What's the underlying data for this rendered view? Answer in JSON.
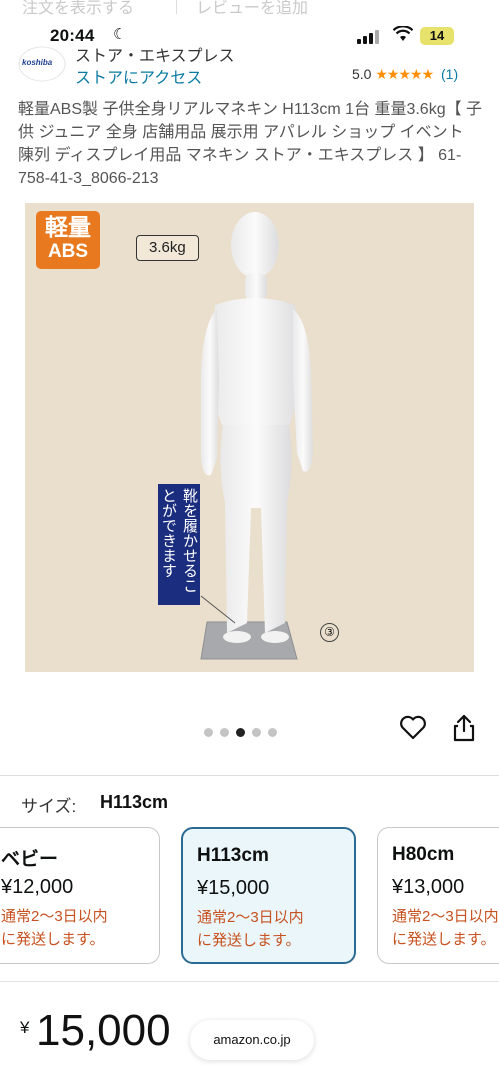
{
  "background_top": {
    "left_text": "注文を表示する",
    "right_text": "レビューを追加"
  },
  "status_bar": {
    "time": "20:44",
    "battery": "14"
  },
  "store": {
    "logo_text": "koshiba",
    "name": "ストア・エキスプレス",
    "link": "ストアにアクセス",
    "rating": "5.0",
    "stars": "★★★★★",
    "rating_count": "(1)"
  },
  "product": {
    "title": "軽量ABS製 子供全身リアルマネキン H113cm 1台 重量3.6kg【 子供 ジュニア 全身 店舗用品 展示用 アパレル ショップ イベント 陳列 ディスプレイ用品 マネキン ストア・エキスプレス 】 61-758-41-3_8066-213",
    "image": {
      "badge_top": "軽量",
      "badge_bottom": "ABS",
      "weight_tag": "3.6kg",
      "note": "靴を履かせることができます",
      "number_mark": "③"
    },
    "carousel": {
      "count": 5,
      "active_index": 2
    }
  },
  "size": {
    "label": "サイズ:",
    "selected": "H113cm",
    "options": [
      {
        "name": "ベビー",
        "price": "¥12,000",
        "shipping": "通常2～3日以内\nに発送します。"
      },
      {
        "name": "H113cm",
        "price": "¥15,000",
        "shipping": "通常2～3日以内\nに発送します。"
      },
      {
        "name": "H80cm",
        "price": "¥13,000",
        "shipping": "通常2～3日以内\nに発送します。"
      }
    ]
  },
  "price": {
    "symbol": "¥",
    "value": "15,000"
  },
  "browser": {
    "url": "amazon.co.jp"
  },
  "colors": {
    "accent_orange": "#e9791f",
    "selected_card_border": "#2b6a92",
    "link_blue": "#0a7aa3",
    "shipping_red": "#c7511f",
    "note_navy": "#1b2d7e"
  }
}
